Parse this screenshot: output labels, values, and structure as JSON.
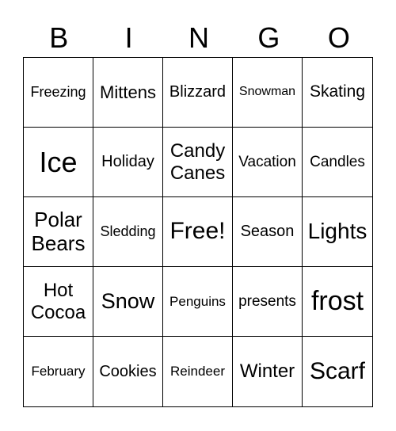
{
  "header": [
    "B",
    "I",
    "N",
    "G",
    "O"
  ],
  "cells": [
    "Freezing",
    "Mittens",
    "Blizzard",
    "Snowman",
    "Skating",
    "Ice",
    "Holiday",
    "Candy Canes",
    "Vacation",
    "Candles",
    "Polar Bears",
    "Sledding",
    "Free!",
    "Season",
    "Lights",
    "Hot Cocoa",
    "Snow",
    "Penguins",
    "presents",
    "frost",
    "February",
    "Cookies",
    "Reindeer",
    "Winter",
    "Scarf"
  ]
}
